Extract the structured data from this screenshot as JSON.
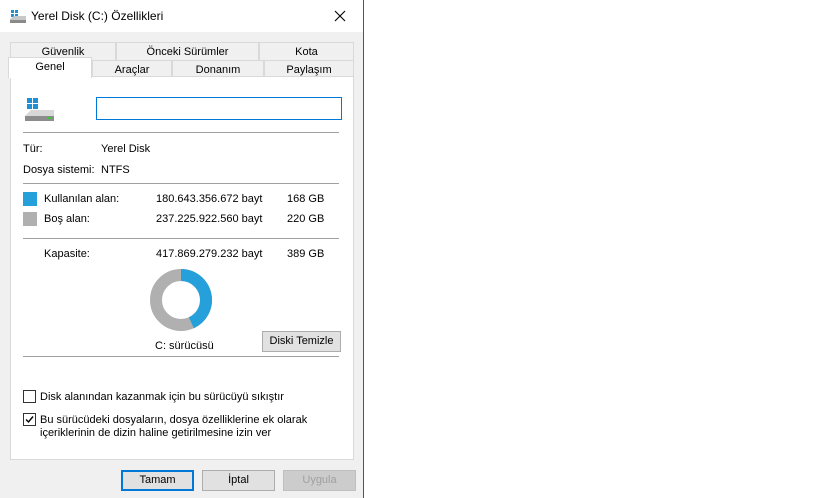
{
  "window": {
    "title": "Yerel Disk (C:) Özellikleri"
  },
  "tabs_back": [
    "Güvenlik",
    "Önceki Sürümler",
    "Kota"
  ],
  "tabs_front": [
    "Genel",
    "Araçlar",
    "Donanım",
    "Paylaşım"
  ],
  "general": {
    "name_value": "",
    "type_label": "Tür:",
    "type_value": "Yerel Disk",
    "fs_label": "Dosya sistemi:",
    "fs_value": "NTFS",
    "used_label": "Kullanılan alan:",
    "used_bytes": "180.643.356.672 bayt",
    "used_gb": "168 GB",
    "free_label": "Boş alan:",
    "free_bytes": "237.225.922.560 bayt",
    "free_gb": "220 GB",
    "capacity_label": "Kapasite:",
    "capacity_bytes": "417.869.279.232 bayt",
    "capacity_gb": "389 GB",
    "drive_label": "C: sürücüsü",
    "cleanup_button": "Diski Temizle",
    "used_fraction": 0.432,
    "used_color": "#26a0da",
    "free_color": "#b0b0b0"
  },
  "options": {
    "compress_label": "Disk alanından kazanmak için bu sürücüyü sıkıştır",
    "compress_checked": false,
    "index_label_line1": "Bu sürücüdeki dosyaların, dosya özelliklerine ek olarak",
    "index_label_line2": "içeriklerinin de dizin haline getirilmesine izin ver",
    "index_checked": true
  },
  "buttons": {
    "ok": "Tamam",
    "cancel": "İptal",
    "apply": "Uygula"
  }
}
